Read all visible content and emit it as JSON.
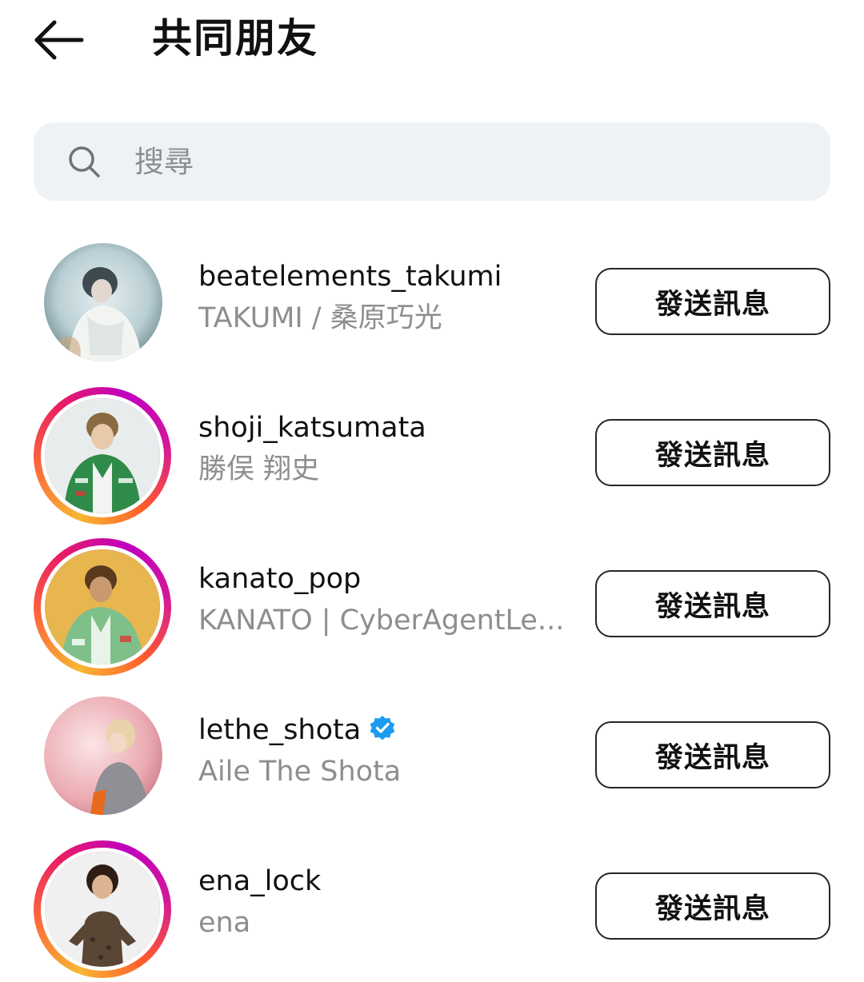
{
  "header": {
    "back_icon": "arrow-left-icon",
    "title": "共同朋友"
  },
  "search": {
    "icon": "search-icon",
    "placeholder": "搜尋"
  },
  "users": [
    {
      "username": "beatelements_takumi",
      "full_name": "TAKUMI / 桑原巧光",
      "verified": false,
      "story_ring": false,
      "button_label": "發送訊息"
    },
    {
      "username": "shoji_katsumata",
      "full_name": "勝俣 翔史",
      "verified": false,
      "story_ring": true,
      "button_label": "發送訊息"
    },
    {
      "username": "kanato_pop",
      "full_name": "KANATO | CyberAgentLe...",
      "verified": false,
      "story_ring": true,
      "button_label": "發送訊息"
    },
    {
      "username": "lethe_shota",
      "full_name": "Aile The Shota",
      "verified": true,
      "verified_icon": "verified-badge-icon",
      "verified_color": "#1d9bf0",
      "story_ring": false,
      "button_label": "發送訊息"
    },
    {
      "username": "ena_lock",
      "full_name": "ena",
      "verified": false,
      "story_ring": true,
      "button_label": "發送訊息"
    }
  ]
}
